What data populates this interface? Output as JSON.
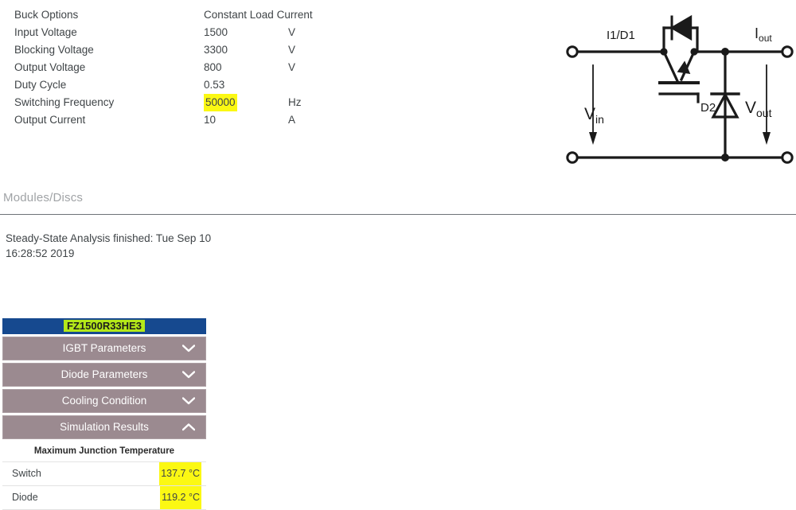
{
  "parameters": {
    "rows": [
      {
        "label": "Buck Options",
        "value": "Constant Load Current",
        "unit": "",
        "highlight": false
      },
      {
        "label": "Input Voltage",
        "value": "1500",
        "unit": "V",
        "highlight": false
      },
      {
        "label": "Blocking Voltage",
        "value": "3300",
        "unit": "V",
        "highlight": false
      },
      {
        "label": "Output Voltage",
        "value": "800",
        "unit": "V",
        "highlight": false
      },
      {
        "label": "Duty Cycle",
        "value": "0.53",
        "unit": "",
        "highlight": false
      },
      {
        "label": "Switching Frequency",
        "value": "50000",
        "unit": "Hz",
        "highlight": true
      },
      {
        "label": "Output Current",
        "value": "10",
        "unit": "A",
        "highlight": false
      }
    ]
  },
  "circuit": {
    "labels": {
      "switch": "I1/D1",
      "diode": "D2",
      "input_current": "",
      "output_current": "I",
      "output_current_sub": "out",
      "input_voltage": "V",
      "input_voltage_sub": "in",
      "output_voltage": "V",
      "output_voltage_sub": "out"
    },
    "stroke_color": "#1a1a1a"
  },
  "section": {
    "heading": "Modules/Discs"
  },
  "status": {
    "text": "Steady-State Analysis finished: Tue Sep 10 16:28:52 2019"
  },
  "module_panel": {
    "title": "FZ1500R33HE3",
    "title_bg": "#16498f",
    "title_highlight": "#b4e819",
    "accordion_bg": "#9b8a90",
    "sections": [
      {
        "label": "IGBT Parameters",
        "expanded": false,
        "icon": "chevron-down-icon"
      },
      {
        "label": "Diode Parameters",
        "expanded": false,
        "icon": "chevron-down-icon"
      },
      {
        "label": "Cooling Condition",
        "expanded": false,
        "icon": "chevron-down-icon"
      },
      {
        "label": "Simulation Results",
        "expanded": true,
        "icon": "chevron-up-icon"
      }
    ],
    "results": {
      "subheader": "Maximum Junction Temperature",
      "rows": [
        {
          "label": "Switch",
          "value": "137.7 °C",
          "highlight": true
        },
        {
          "label": "Diode",
          "value": "119.2 °C",
          "highlight": true
        }
      ]
    },
    "highlight_color": "#fbf813"
  }
}
